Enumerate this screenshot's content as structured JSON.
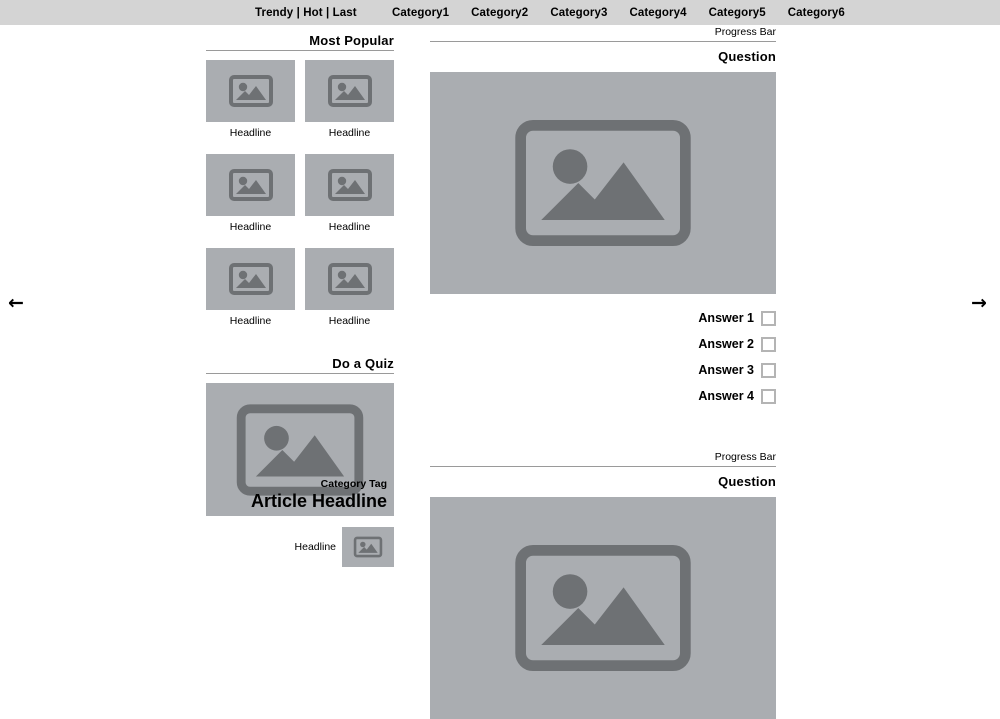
{
  "header": {
    "trendy_nav": "Trendy | Hot | Last",
    "categories": [
      {
        "label": "Category1"
      },
      {
        "label": "Category2"
      },
      {
        "label": "Category3"
      },
      {
        "label": "Category4"
      },
      {
        "label": "Category5"
      },
      {
        "label": "Category6"
      }
    ]
  },
  "nav_arrows": {
    "left": "←",
    "right": "→"
  },
  "left_column": {
    "most_popular": {
      "title": "Most Popular",
      "items": [
        {
          "caption": "Headline"
        },
        {
          "caption": "Headline"
        },
        {
          "caption": "Headline"
        },
        {
          "caption": "Headline"
        },
        {
          "caption": "Headline"
        },
        {
          "caption": "Headline"
        }
      ]
    },
    "quiz": {
      "title": "Do a Quiz",
      "card": {
        "category_tag": "Category Tag",
        "headline": "Article Headline"
      },
      "list_items": [
        {
          "label": "Headline"
        }
      ]
    }
  },
  "right_column": {
    "questions": [
      {
        "progress_label": "Progress Bar",
        "title": "Question",
        "answers": [
          {
            "label": "Answer 1",
            "checked": false
          },
          {
            "label": "Answer 2",
            "checked": false
          },
          {
            "label": "Answer 3",
            "checked": false
          },
          {
            "label": "Answer 4",
            "checked": false
          }
        ]
      },
      {
        "progress_label": "Progress Bar",
        "title": "Question",
        "answers": []
      }
    ]
  },
  "colors": {
    "header_bar": "#d4d4d4",
    "placeholder_bg": "#aaadb1",
    "placeholder_icon": "#6e7174",
    "rule": "#9a9a9a",
    "checkbox_border": "#b4b4b4",
    "page_bg": "#ffffff"
  },
  "icons": {
    "image_placeholder": "image-placeholder-icon",
    "arrow_left": "arrow-left-icon",
    "arrow_right": "arrow-right-icon"
  }
}
